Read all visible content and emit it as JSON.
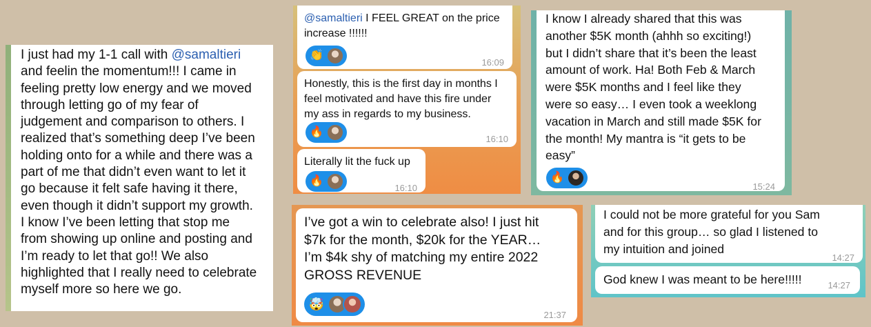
{
  "colors": {
    "background": "#cfbfa8",
    "reaction_pill": "#1e8fe8",
    "mention": "#2b5fb0",
    "timestamp": "#9a9a9a"
  },
  "card1": {
    "text_line1_pre": "I just had my 1-1 call with ",
    "mention": "@samaltieri",
    "body": "and feelin the momentum!!! I came in\nfeeling pretty low energy and we moved\nthrough letting go of my fear of\njudgement and comparison to others. I\nrealized that’s something deep I’ve been\nholding onto for a while and there was a\npart of me that didn’t even want to let it\ngo because it felt safe having it there,\neven though it didn’t support my growth.\nI know I’ve been letting that stop me\nfrom showing up online and posting and\nI’m ready to let that go!! We also\nhighlighted that I really need to celebrate\nmyself more so here we go."
  },
  "card2": {
    "msg1": {
      "mention": "@samaltieri",
      "text": " I FEEL GREAT on the price\nincrease !!!!!!",
      "reaction_icon": "clapping-hands-icon",
      "reaction_emoji": "👏",
      "time": "16:09"
    },
    "msg2": {
      "text": "Honestly, this is the first day in months I\nfeel motivated and have this fire under\nmy ass in regards to my business.",
      "reaction_icon": "fire-icon",
      "reaction_emoji": "🔥",
      "time": "16:10"
    },
    "msg3": {
      "text": "Literally lit the fuck up",
      "reaction_icon": "fire-icon",
      "reaction_emoji": "🔥",
      "time": "16:10"
    }
  },
  "card3": {
    "text": "I know I already shared that this was\nanother $5K month (ahhh so exciting!)\nbut I didn’t share that it’s been the least\namount of work. Ha! Both Feb & March\nwere $5K months and I feel like they\nwere so easy… I even took a weeklong\nvacation in March and still made $5K for\nthe month! My mantra is “it gets to be\neasy”",
    "reaction_icon": "fire-icon",
    "reaction_emoji": "🔥",
    "time": "15:24"
  },
  "card4": {
    "text": "I’ve got a win to celebrate also! I just hit\n$7k for the month, $20k for the YEAR…\nI’m $4k shy of matching my entire 2022\nGROSS REVENUE",
    "reaction_icon": "exploding-head-icon",
    "reaction_emoji": "🤯",
    "time": "21:37"
  },
  "card5": {
    "msg1": {
      "text": "I could not be more grateful for you Sam\nand for this group… so glad I listened to\nmy intuition and joined",
      "time": "14:27"
    },
    "msg2": {
      "text": "God knew I was meant to be here!!!!!",
      "time": "14:27"
    }
  }
}
